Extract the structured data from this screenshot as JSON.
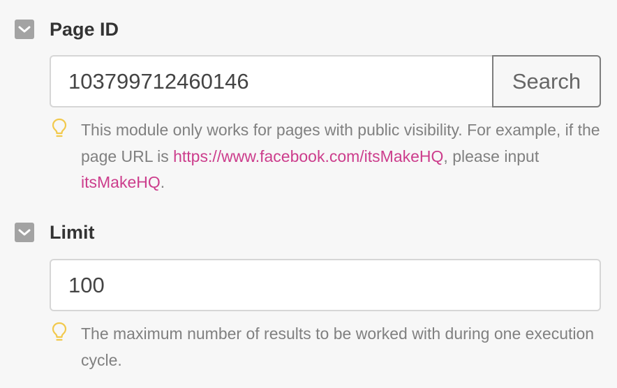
{
  "page_id": {
    "label": "Page ID",
    "value": "103799712460146",
    "search_label": "Search",
    "hint": {
      "before_link": "This module only works for pages with public visibility. For example, if the page URL is ",
      "link_url_text": "https://www.facebook.com/itsMakeHQ",
      "middle": ", please input ",
      "link_id_text": "itsMakeHQ",
      "end": "."
    }
  },
  "limit": {
    "label": "Limit",
    "value": "100",
    "hint": "The maximum number of results to be worked with during one execution cycle."
  },
  "colors": {
    "background": "#f7f7f7",
    "toggle": "#a3a3a3",
    "link": "#cc3d8c",
    "hint_text": "#808080",
    "bulb": "#f2c94c"
  },
  "icons": {
    "toggle": "chevron-down-icon",
    "hint": "lightbulb-icon"
  }
}
